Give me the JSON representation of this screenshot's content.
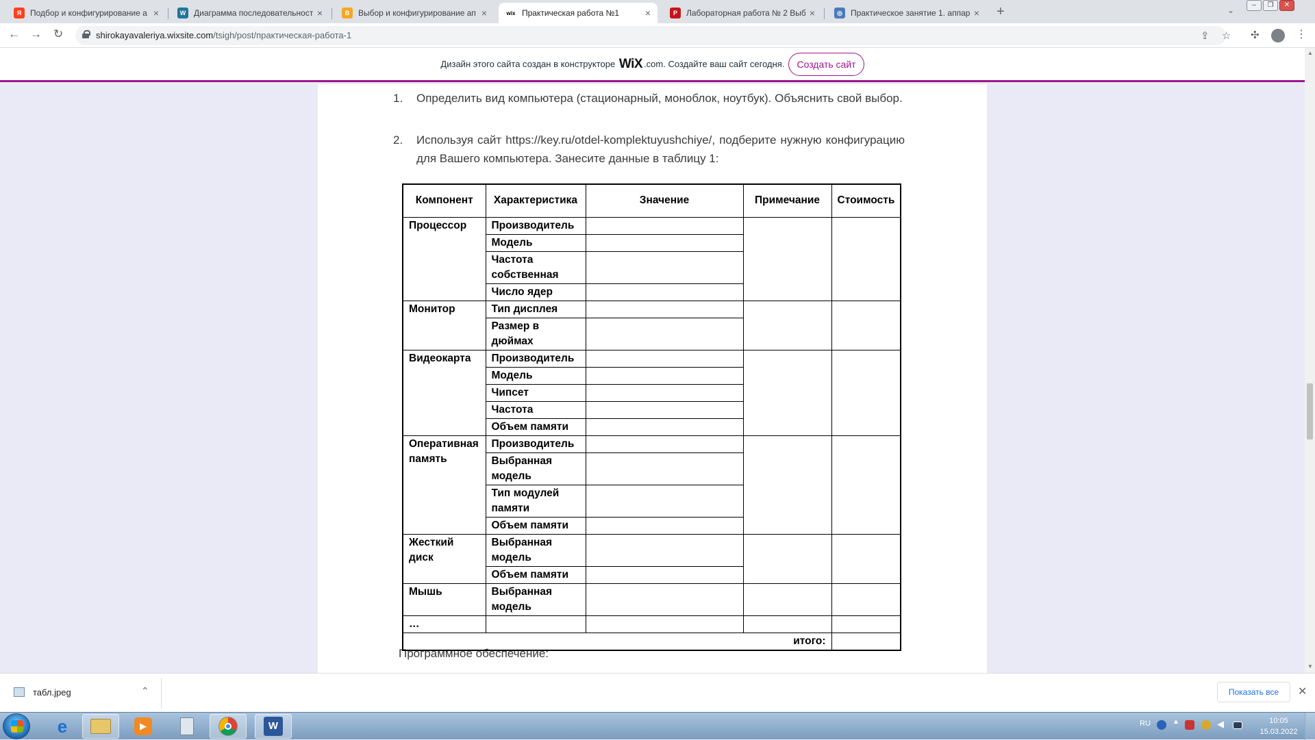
{
  "browser": {
    "tabs": [
      {
        "title": "Подбор и конфигурирование а",
        "favicon": "yandex-icon",
        "color": "#fc3f1d",
        "glyph": "Я"
      },
      {
        "title": "Диаграмма последовательност",
        "favicon": "wordpress-icon",
        "color": "#21759b",
        "glyph": "W"
      },
      {
        "title": "Выбор и конфигурирование ап",
        "favicon": "blogger-icon",
        "color": "#f5a623",
        "glyph": "B"
      },
      {
        "title": "Практическая работа №1",
        "favicon": "wix-icon",
        "color": "#ffffff",
        "glyph": "wix"
      },
      {
        "title": "Лабораторная работа № 2 Выб",
        "favicon": "pdf-icon",
        "color": "#c4151c",
        "glyph": "P"
      },
      {
        "title": "Практическое занятие 1. аппар",
        "favicon": "globe-icon",
        "color": "#4a7bb8",
        "glyph": "◎"
      }
    ],
    "url_host": "shirokayavaleriya.wixsite.com",
    "url_path": "/tsigh/post/практическая-работа-1"
  },
  "wix_banner": {
    "text_before": "Дизайн этого сайта создан в конструкторе",
    "brand": "WiX",
    "text_after": ".com. Создайте ваш сайт сегодня.",
    "button": "Создать сайт"
  },
  "article": {
    "items": [
      {
        "num": "1.",
        "text": "Определить вид компьютера (стационарный, моноблок, ноутбук). Объяснить свой выбор."
      },
      {
        "num": "2.",
        "text": "Используя сайт https://key.ru/otdel-komplektuyushchiye/, подберите нужную конфигурацию для Вашего компьютера. Занесите данные в таблицу 1:"
      }
    ],
    "table": {
      "headers": [
        "Компонент",
        "Характеристика",
        "Значение",
        "Примечание",
        "Стоимость"
      ],
      "groups": [
        {
          "component": "Процессор",
          "chars": [
            "Производитель",
            "Модель",
            "Частота собственная",
            "Число ядер"
          ]
        },
        {
          "component": "Монитор",
          "chars": [
            "Тип дисплея",
            "Размер в дюймах"
          ]
        },
        {
          "component": "Видеокарта",
          "chars": [
            "Производитель",
            "Модель",
            "Чипсет",
            "Частота",
            "Объем памяти"
          ]
        },
        {
          "component": "Оперативная память",
          "chars": [
            "Производитель",
            "Выбранная модель",
            "Тип модулей памяти",
            "Объем памяти"
          ]
        },
        {
          "component": "Жесткий диск",
          "chars": [
            "Выбранная модель",
            "Объем памяти"
          ]
        },
        {
          "component": "Мышь",
          "chars": [
            "Выбранная модель"
          ]
        },
        {
          "component": "…",
          "chars": [
            ""
          ]
        }
      ],
      "total_label": "итого:"
    },
    "next_heading": "Программное обеспечение:"
  },
  "downloads": {
    "file": "табл.jpeg",
    "show_all": "Показать все"
  },
  "taskbar": {
    "lang": "RU",
    "time": "10:05",
    "date": "15.03.2022"
  }
}
